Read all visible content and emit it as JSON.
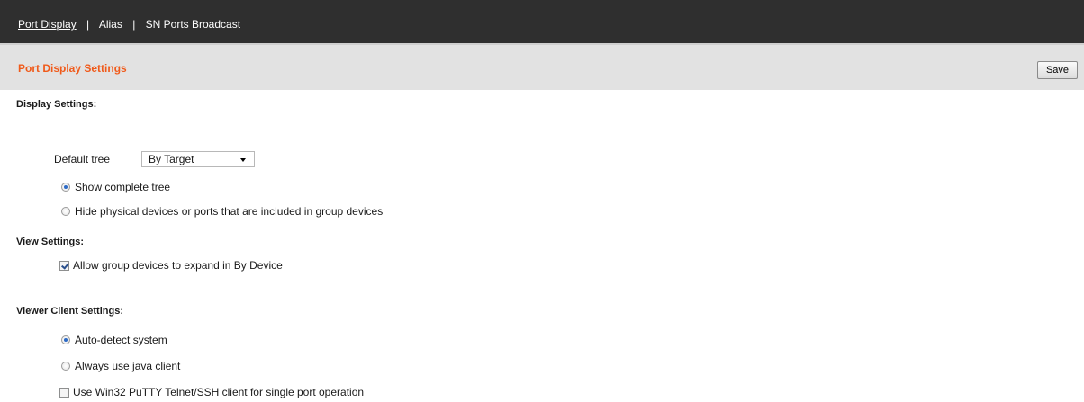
{
  "topnav": {
    "items": [
      {
        "label": "Port Display",
        "active": true
      },
      {
        "label": "Alias",
        "active": false
      },
      {
        "label": "SN Ports Broadcast",
        "active": false
      }
    ],
    "separator": "|"
  },
  "subheader": {
    "title": "Port Display Settings",
    "save_label": "Save"
  },
  "display_settings": {
    "title": "Display Settings:",
    "default_tree_label": "Default tree",
    "default_tree_value": "By Target",
    "options": [
      {
        "label": "Show complete tree",
        "selected": true
      },
      {
        "label": "Hide physical devices or ports that are included in group devices",
        "selected": false
      }
    ]
  },
  "view_settings": {
    "title": "View Settings:",
    "allow_group_expand": {
      "label": "Allow group devices to expand in By Device",
      "checked": true
    }
  },
  "viewer_client_settings": {
    "title": "Viewer Client Settings:",
    "options": [
      {
        "label": "Auto-detect system",
        "selected": true
      },
      {
        "label": "Always use java client",
        "selected": false
      }
    ],
    "use_putty": {
      "label": "Use Win32 PuTTY Telnet/SSH client for single port operation",
      "checked": false
    }
  },
  "colors": {
    "nav_bg": "#2f2f2f",
    "subheader_bg": "#e2e2e2",
    "title_accent": "#f05a1a"
  }
}
